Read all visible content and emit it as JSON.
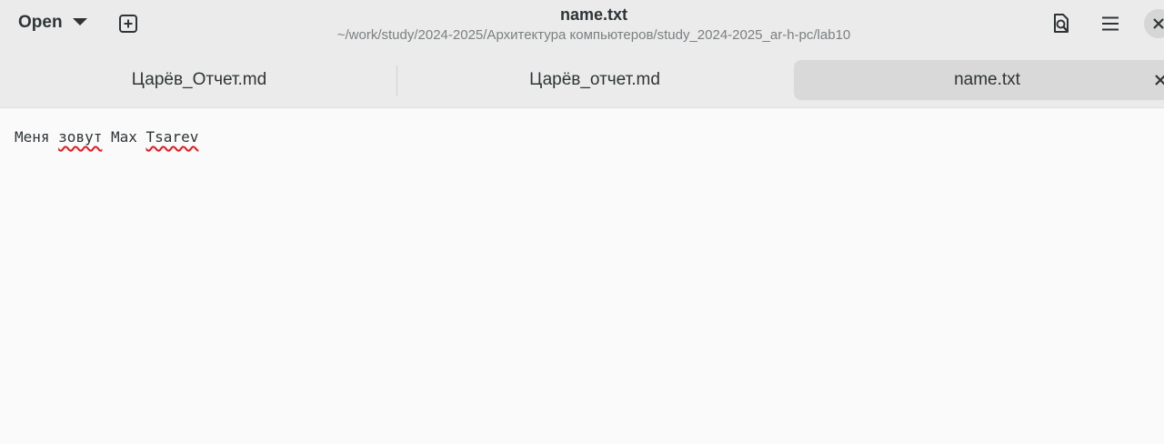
{
  "header": {
    "open_label": "Open",
    "title": "name.txt",
    "subtitle": "~/work/study/2024-2025/Архитектура компьютеров/study_2024-2025_ar-h-pc/lab10"
  },
  "icons": {
    "open_menu": "chevron-down-icon",
    "new_tab": "new-tab-plus-icon",
    "search": "document-search-icon",
    "menu": "hamburger-menu-icon",
    "close": "close-icon"
  },
  "tabs": [
    {
      "label": "Царёв_Отчет.md",
      "active": false
    },
    {
      "label": "Царёв_отчет.md",
      "active": false
    },
    {
      "label": "name.txt",
      "active": true
    }
  ],
  "editor": {
    "words": [
      "Меня",
      " ",
      "зовут",
      " ",
      "Max",
      " ",
      "Tsarev"
    ],
    "misspelled": [
      "зовут",
      "Tsarev"
    ]
  },
  "colors": {
    "headerbar": "#ebebeb",
    "active_tab": "#d9d9d9",
    "editor_bg": "#fafafa",
    "spellcheck_underline": "#e01b24"
  }
}
